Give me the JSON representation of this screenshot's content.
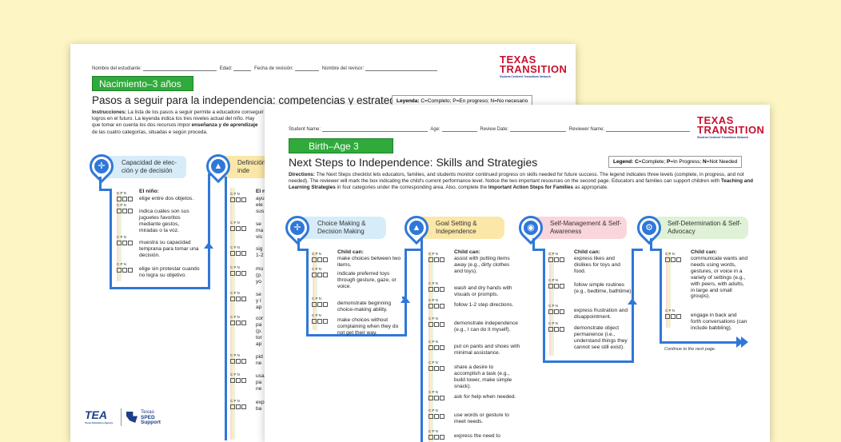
{
  "back_page": {
    "header": {
      "student_label": "Nombre del estudiante:",
      "age_label": "Edad:",
      "review_date_label": "Fecha de revisión:",
      "reviewer_label": "Nombre del revisor:"
    },
    "logo": {
      "line1": "TEXAS",
      "line2": "TRANSITION",
      "tagline": "Student-Centered Transitions Network"
    },
    "age_badge": "Nacimiento–3 años",
    "title": "Pasos a seguir para la independencia: competencias y estrategias",
    "legend": {
      "label": "Leyenda:",
      "text": "C=Completo; P=En progreso; N=No necesario"
    },
    "directions": {
      "label": "Instrucciones:",
      "text": "La lista de los pasos a seguir permite a educadore conseguir logros en el futuro. La leyenda indica los tres niveles actual del niño. Hay que tomar en cuenta los dos recursos impor",
      "bold": "enseñanza y de aprendizaje",
      "text2": "de las cuatro categorías, situadas e según proceda."
    },
    "categories": [
      {
        "label": "Capacidad de elec-ción y de decisión",
        "icon": "crosshair-icon"
      },
      {
        "label": "Definición vos e inde",
        "icon": "mountain-flag-icon"
      }
    ],
    "child_can": "El niño:",
    "cpn": "C P N",
    "items_col1": [
      "elige entre dos objetos.",
      "indica cuáles son sus juguetes favoritos mediante gestos, miradas o la voz.",
      "muestra su capacidad temprana para tomar una decisión.",
      "elige sin protestar cuando no logra su objetivo."
    ],
    "items_col2_fragments": [
      "El n",
      "ayu ele sus",
      "se ma vis",
      "sig 1-2",
      "mu (p. yo",
      "se y l ap",
      "cor pa (p. tor ap",
      "pid ne",
      "usa pa ne",
      "exp ba"
    ],
    "footer": {
      "tea": "TEA",
      "agency": "Texas Education Agency",
      "sped_line1": "Texas",
      "sped_line2": "SPED",
      "sped_line3": "Support"
    }
  },
  "front_page": {
    "header": {
      "student_label": "Student Name:",
      "age_label": "Age:",
      "review_date_label": "Review Date:",
      "reviewer_label": "Reviewer Name:"
    },
    "logo": {
      "line1": "TEXAS",
      "line2": "TRANSITION",
      "tagline": "Student-Centered Transitions Network"
    },
    "age_badge": "Birth–Age 3",
    "title": "Next Steps to Independence: Skills and Strategies",
    "legend": {
      "label": "Legend:",
      "c": "C",
      "c_text": "=Complete; ",
      "p": "P",
      "p_text": "=In Progress; ",
      "n": "N",
      "n_text": "=Not Needed"
    },
    "directions": {
      "label": "Directions:",
      "text": "The Next Steps checklist lets educators, families, and students monitor continued progress on skills needed for future success. The legend indicates three levels (complete, in progress, and not needed). The reviewer will mark the box indicating the child's current performance level. Notice the two important resources on the second page. Educators and families can support children with",
      "bold1": "Teaching and Learning Strategies",
      "text2": "in four categories under the corresponding area. Also, complete the",
      "bold2": "Important Action Steps for Families",
      "text3": "as appropriate."
    },
    "categories": [
      {
        "label": "Choice Making & Decision Making",
        "icon": "crosshair-icon",
        "color": "#d6ecf8"
      },
      {
        "label": "Goal Setting & Independence",
        "icon": "mountain-flag-icon",
        "color": "#fbe7a8"
      },
      {
        "label": "Self-Management & Self-Awareness",
        "icon": "person-radar-icon",
        "color": "#f9d5dc"
      },
      {
        "label": "Self-Determination & Self-Advocacy",
        "icon": "head-gear-icon",
        "color": "#dff1d6"
      }
    ],
    "child_can": "Child can:",
    "cpn": "C P N",
    "columns": [
      {
        "items": [
          "make choices between two items.",
          "indicate preferred toys through gesture, gaze, or voice.",
          "demonstrate beginning choice-making ability.",
          "make choices without complaining when they do not get their way."
        ]
      },
      {
        "items": [
          "assist with putting items away (e.g., dirty clothes and toys).",
          "wash and dry hands with visuals or prompts.",
          "follow 1-2 step directions.",
          "demonstrate independence (e.g., I can do it myself).",
          "put on pants and shoes with minimal assistance.",
          "share a desire to accomplish a task (e.g., build tower, make simple snack).",
          "ask for help when needed.",
          "use words or gesture to meet needs.",
          "express the need to"
        ]
      },
      {
        "items": [
          "express likes and dislikes for toys and food.",
          "follow simple routines (e.g., bedtime, bathtime).",
          "express frustration and disappointment.",
          "demonstrate object permanence (i.e., understand things they cannot see still exist)."
        ]
      },
      {
        "items": [
          "communicate wants and needs using words, gestures, or voice in a variety of settings (e.g., with peers, with adults, in large and small groups).",
          "engage in back and forth conversations (can include babbling)."
        ]
      }
    ],
    "continue": "Continue to the next page.",
    "accent": "#2f78d8",
    "badge_green": "#2faa3b",
    "logo_red": "#c8102e"
  }
}
